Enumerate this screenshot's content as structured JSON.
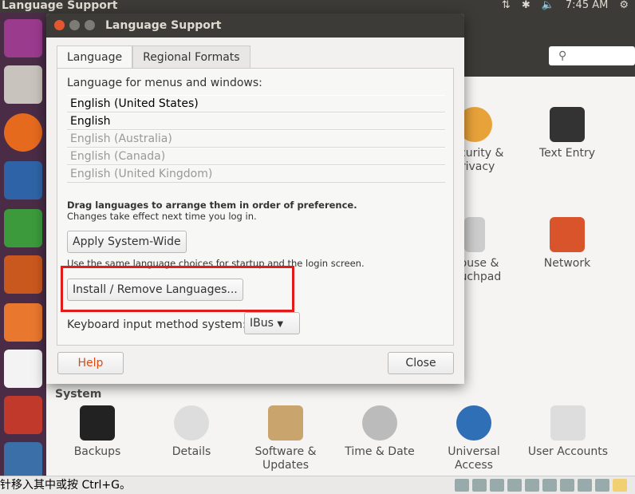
{
  "topbar": {
    "title": "Language Support",
    "time": "7:45 AM",
    "icons": [
      "network-icon",
      "bluetooth-icon",
      "volume-icon",
      "gear-icon"
    ]
  },
  "launcher": {
    "items": [
      "ubuntu-icon",
      "files-icon",
      "firefox-icon",
      "writer-icon",
      "calc-icon",
      "impress-icon",
      "software-center-icon",
      "amazon-icon",
      "system-settings-icon",
      "workspace-icon"
    ]
  },
  "settings": {
    "items_top": [
      "Security & Privacy",
      "Text Entry"
    ],
    "items_mid": [
      "Mouse & Touchpad",
      "Network"
    ],
    "section": "System",
    "system_items": [
      "Backups",
      "Details",
      "Software & Updates",
      "Time & Date",
      "Universal Access",
      "User Accounts"
    ]
  },
  "statusbar": {
    "text": "针移入其中或按 Ctrl+G。"
  },
  "dialog": {
    "title": "Language Support",
    "tabs": [
      "Language",
      "Regional Formats"
    ],
    "list_label": "Language for menus and windows:",
    "languages": [
      "English (United States)",
      "English",
      "English (Australia)",
      "English (Canada)",
      "English (United Kingdom)"
    ],
    "drag_hint": "Drag languages to arrange them in order of preference.",
    "change_hint": "Changes take effect next time you log in.",
    "apply_button": "Apply System-Wide",
    "apply_hint": "Use the same language choices for startup and the login screen.",
    "install_button": "Install / Remove Languages...",
    "keyboard_label": "Keyboard input method system:",
    "keyboard_value": "IBus",
    "help_button": "Help",
    "close_button": "Close"
  },
  "colors": {
    "highlight": "#e21b1b",
    "help": "#dd4814"
  }
}
